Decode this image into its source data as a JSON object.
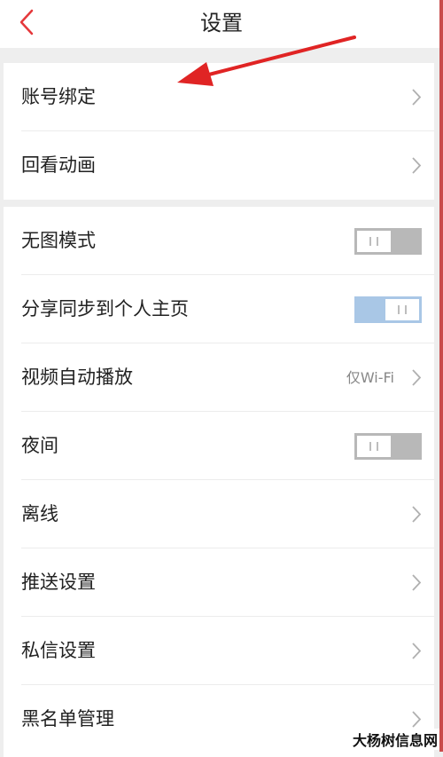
{
  "header": {
    "title": "设置",
    "back_icon": "back-chevron-icon",
    "accent_color": "#e5383b"
  },
  "groups": [
    {
      "items": [
        {
          "label": "账号绑定",
          "control": "chevron"
        },
        {
          "label": "回看动画",
          "control": "chevron"
        }
      ]
    },
    {
      "items": [
        {
          "label": "无图模式",
          "control": "toggle",
          "on": false
        },
        {
          "label": "分享同步到个人主页",
          "control": "toggle",
          "on": true
        },
        {
          "label": "视频自动播放",
          "control": "chevron",
          "value": "仅Wi-Fi"
        },
        {
          "label": "夜间",
          "control": "toggle",
          "on": false
        },
        {
          "label": "离线",
          "control": "chevron"
        },
        {
          "label": "推送设置",
          "control": "chevron"
        },
        {
          "label": "私信设置",
          "control": "chevron"
        },
        {
          "label": "黑名单管理",
          "control": "chevron"
        }
      ]
    }
  ],
  "annotation": {
    "arrow_color": "#e02424",
    "points_to": "账号绑定"
  },
  "watermark": "大杨树信息网",
  "colors": {
    "toggle_off": "#b8b8b8",
    "toggle_on": "#a9c7e6",
    "background": "#eeeeee"
  }
}
